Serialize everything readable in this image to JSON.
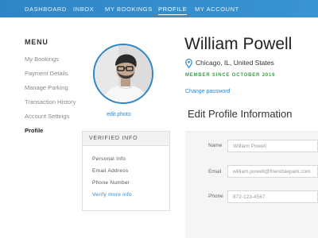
{
  "nav": {
    "items": [
      {
        "label": "DASHBOARD"
      },
      {
        "label": "INBOX"
      },
      {
        "label": "MY BOOKINGS"
      },
      {
        "label": "PROFILE",
        "active": true
      },
      {
        "label": "MY ACCOUNT"
      }
    ]
  },
  "menu": {
    "title": "MENU",
    "items": [
      {
        "label": "My Bookings"
      },
      {
        "label": "Payment Details"
      },
      {
        "label": "Manage Parking"
      },
      {
        "label": "Transaction History"
      },
      {
        "label": "Account Settings"
      },
      {
        "label": "Profile",
        "active": true
      }
    ]
  },
  "profile": {
    "edit_photo": "edit photo",
    "name": "William Powell",
    "location": "Chicago, IL, United States",
    "member_since": "MEMBER SINCE OCTOBER 2016",
    "change_password": "Change password"
  },
  "verified": {
    "title": "VERIFIED INFO",
    "items": [
      "Personal Info",
      "Email Address",
      "Phone Number"
    ],
    "link": "Verify more info"
  },
  "edit_form": {
    "title": "Edit Profile Information",
    "fields": [
      {
        "label": "Name",
        "value": "William Powell"
      },
      {
        "label": "Email",
        "value": "william.powell@friendsiepark.com"
      },
      {
        "label": "Phone",
        "value": "872-123-4567"
      }
    ]
  },
  "colors": {
    "accent": "#2f86c6",
    "member_green": "#3aa34a"
  }
}
